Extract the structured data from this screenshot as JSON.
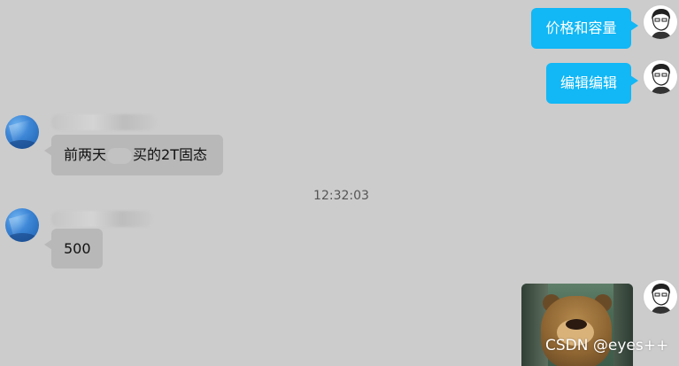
{
  "messages": {
    "out_1": {
      "text": "价格和容量"
    },
    "out_2": {
      "text": "编辑编辑"
    },
    "in_1": {
      "text_before": "前两天",
      "text_after": "买的2T固态"
    },
    "timestamp": "12:32:03",
    "in_2": {
      "text": "500"
    }
  },
  "watermark": "CSDN @eyes++"
}
